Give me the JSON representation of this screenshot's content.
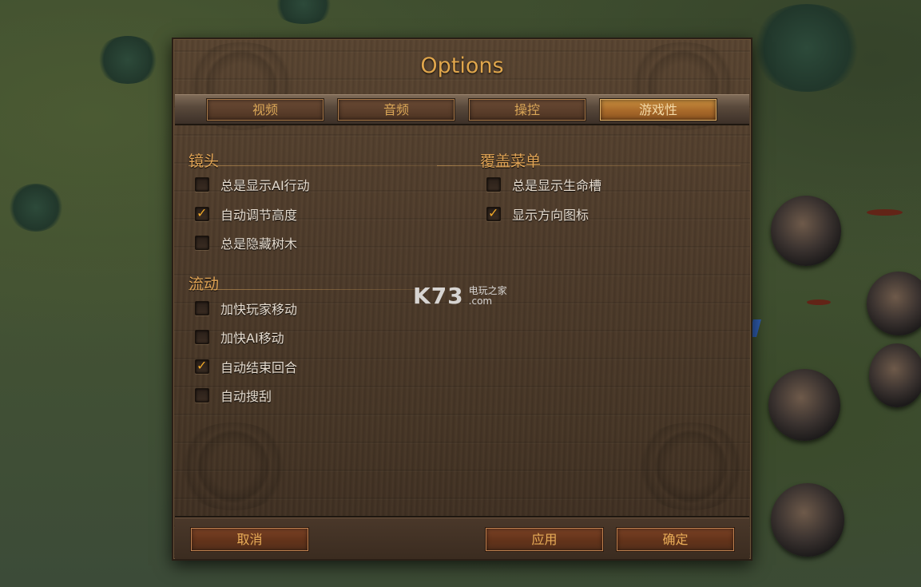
{
  "dialog": {
    "title": "Options"
  },
  "tabs": [
    {
      "label": "视频",
      "active": false
    },
    {
      "label": "音频",
      "active": false
    },
    {
      "label": "操控",
      "active": false
    },
    {
      "label": "游戏性",
      "active": true
    }
  ],
  "sections": {
    "camera": {
      "title": "镜头",
      "options": [
        {
          "label": "总是显示AI行动",
          "checked": false
        },
        {
          "label": "自动调节高度",
          "checked": true
        },
        {
          "label": "总是隐藏树木",
          "checked": false
        }
      ]
    },
    "flow": {
      "title": "流动",
      "options": [
        {
          "label": "加快玩家移动",
          "checked": false
        },
        {
          "label": "加快AI移动",
          "checked": false
        },
        {
          "label": "自动结束回合",
          "checked": true
        },
        {
          "label": "自动搜刮",
          "checked": false
        }
      ]
    },
    "overlay": {
      "title": "覆盖菜单",
      "options": [
        {
          "label": "总是显示生命槽",
          "checked": false
        },
        {
          "label": "显示方向图标",
          "checked": true
        }
      ]
    }
  },
  "footer": {
    "cancel_label": "取消",
    "apply_label": "应用",
    "ok_label": "确定"
  },
  "watermark": {
    "logo": "K73",
    "line1": "电玩之家",
    "line2": ".com"
  },
  "colors": {
    "accent": "#e0a64c",
    "active_tab": "#b87a34",
    "check": "#f0a828"
  },
  "icons": {
    "checked": "checkmark-icon"
  }
}
